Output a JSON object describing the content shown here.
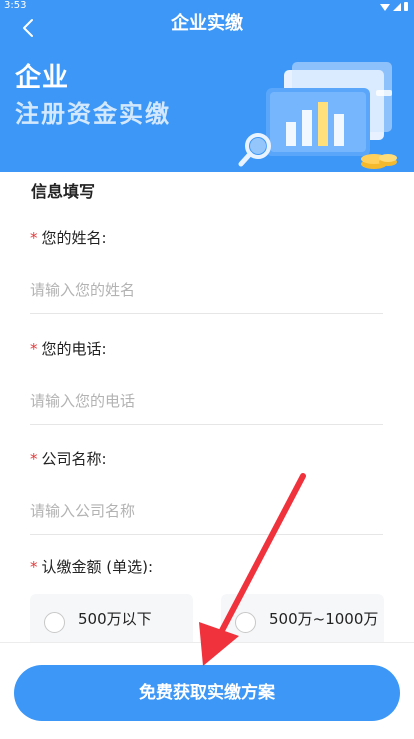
{
  "status_bar": {
    "time": "3:53"
  },
  "nav": {
    "title": "企业实缴"
  },
  "hero": {
    "title": "企业",
    "subtitle": "注册资金实缴"
  },
  "form": {
    "section_title": "信息填写",
    "required_mark": "*",
    "fields": [
      {
        "label": "您的姓名:",
        "placeholder": "请输入您的姓名"
      },
      {
        "label": "您的电话:",
        "placeholder": "请输入您的电话"
      },
      {
        "label": "公司名称:",
        "placeholder": "请输入公司名称"
      }
    ],
    "amount": {
      "label": "认缴金额 (单选):",
      "options": [
        {
          "label": "500万以下",
          "selected": false
        },
        {
          "label": "500万~1000万",
          "selected": false
        }
      ]
    }
  },
  "cta": {
    "label": "免费获取实缴方案"
  },
  "colors": {
    "primary": "#3c97f7",
    "required": "#e33b3b",
    "annotation_arrow": "#f0323c"
  },
  "icons": {
    "back": "chevron-left-icon",
    "wifi": "wifi-icon",
    "signal": "signal-icon",
    "battery": "battery-icon"
  }
}
